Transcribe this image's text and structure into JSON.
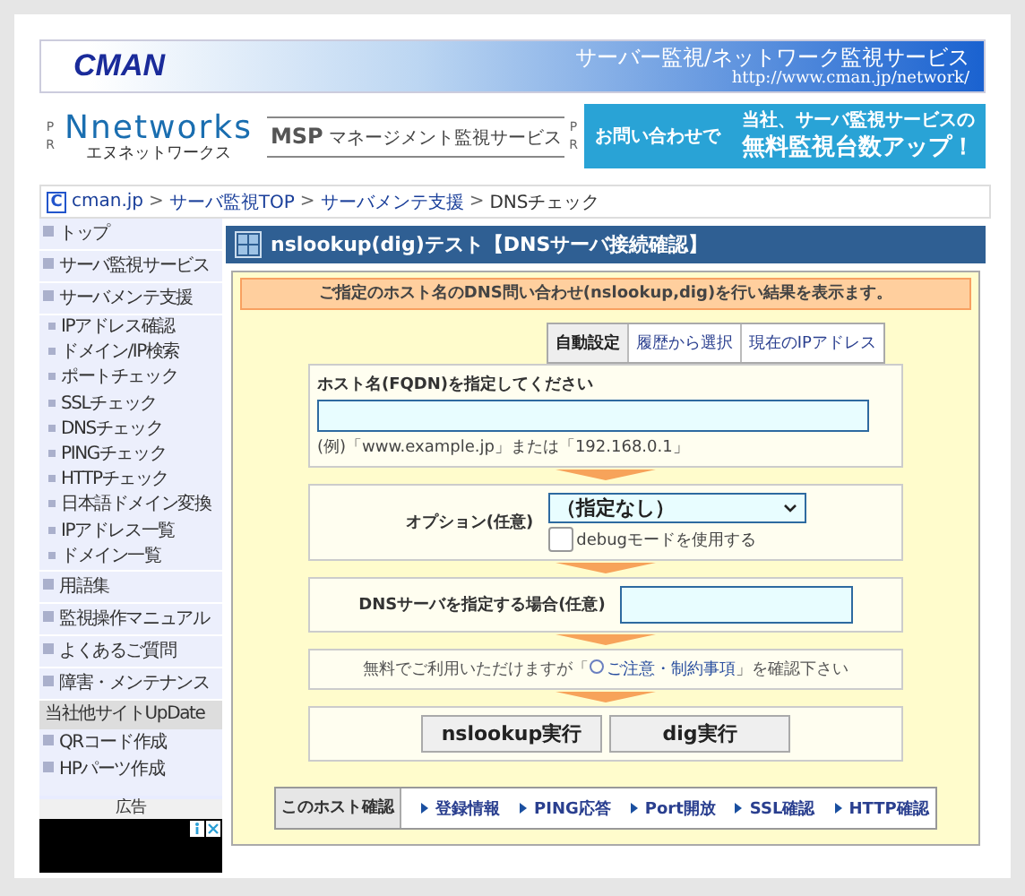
{
  "header": {
    "logo": "CMAN",
    "tagline": "サーバー監視/ネットワーク監視サービス",
    "url": "http://www.cman.jp/network/"
  },
  "ads": [
    {
      "pr": [
        "P",
        "R"
      ],
      "items": [
        {
          "kind": "brand",
          "name": "Nnetworks",
          "sub": "エヌネットワークス"
        },
        {
          "kind": "msp",
          "name": "MSP",
          "sub": "マネージメント監視サービス"
        }
      ]
    },
    {
      "pr": [
        "P",
        "R"
      ],
      "items": [
        {
          "kind": "promo",
          "name": "お問い合わせで",
          "line1": "当社、サーバ監視サービスの",
          "line2": "無料監視台数アップ！"
        }
      ]
    }
  ],
  "breadcrumb": {
    "icon": "C",
    "separator": ">",
    "items": [
      "cman.jp",
      "サーバ監視TOP",
      "サーバメンテ支援",
      "DNSチェック"
    ]
  },
  "sidebar": {
    "items": [
      {
        "label": "トップ"
      },
      {
        "label": "サーバ監視サービス"
      },
      {
        "label": "サーバメンテ支援",
        "children": [
          {
            "label": "IPアドレス確認"
          },
          {
            "label": "ドメイン/IP検索"
          },
          {
            "label": "ポートチェック"
          },
          {
            "label": "SSLチェック"
          },
          {
            "label": "DNSチェック"
          },
          {
            "label": "PINGチェック"
          },
          {
            "label": "HTTPチェック"
          },
          {
            "label": "日本語ドメイン変換"
          },
          {
            "label": "IPアドレス一覧"
          },
          {
            "label": "ドメイン一覧"
          }
        ]
      },
      {
        "label": "用語集"
      },
      {
        "label": "監視操作マニュアル"
      },
      {
        "label": "よくあるご質問"
      },
      {
        "label": "障害・メンテナンス"
      }
    ],
    "other_heading": "当社他サイトUpDate",
    "other_items": [
      {
        "label": "QRコード作成"
      },
      {
        "label": "HPパーツ作成"
      }
    ],
    "ad_label": "広告"
  },
  "panel": {
    "title": "nslookup(dig)テスト【DNSサーバ接続確認】",
    "notice": "ご指定のホスト名のDNS問い合わせ(nslookup,dig)を行い結果を表示ます。",
    "tabs": [
      {
        "label": "自動設定",
        "selected": true
      },
      {
        "label": "履歴から選択",
        "selected": false
      },
      {
        "label": "現在のIPアドレス",
        "selected": false
      }
    ],
    "host": {
      "label": "ホスト名(FQDN)を指定してください",
      "hint": "(例)「www.example.jp」または「192.168.0.1」"
    },
    "option": {
      "label": "オプション(任意)",
      "value": "（指定なし）",
      "debug": {
        "label": "debugモードを使用する",
        "checked": false
      }
    },
    "dns_server": {
      "label": "DNSサーバを指定する場合(任意)"
    },
    "terms": {
      "before": "無料でご利用いただけますが「",
      "link": "ご注意・制約事項",
      "after": "」を確認下さい"
    },
    "buttons": [
      "nslookup実行",
      "dig実行"
    ],
    "host_check": {
      "label": "このホスト確認",
      "links": [
        "登録情報",
        "PING応答",
        "Port開放",
        "SSL確認",
        "HTTP確認"
      ]
    }
  }
}
